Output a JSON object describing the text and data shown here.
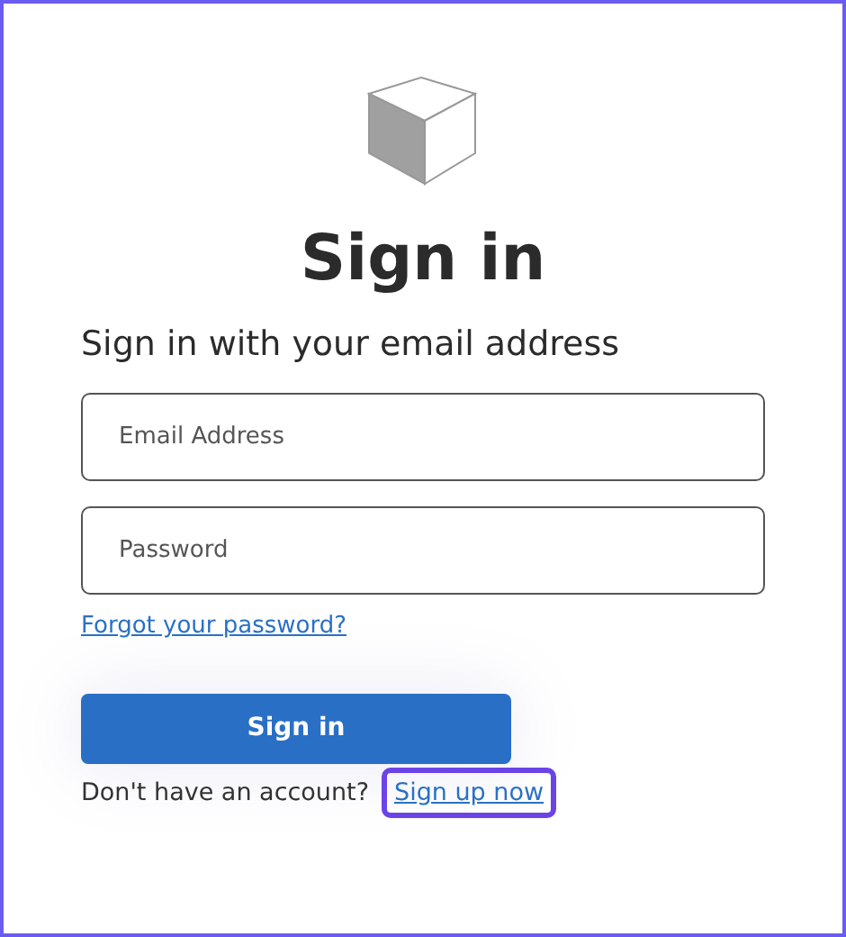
{
  "title": "Sign in",
  "subtitle": "Sign in with your email address",
  "fields": [
    {
      "placeholder": "Email Address"
    },
    {
      "placeholder": "Password"
    }
  ],
  "forgot_link": "Forgot your password?",
  "submit_button": "Sign in",
  "signup": {
    "prompt": "Don't have an account?",
    "link": "Sign up now",
    "highlighted": true
  }
}
